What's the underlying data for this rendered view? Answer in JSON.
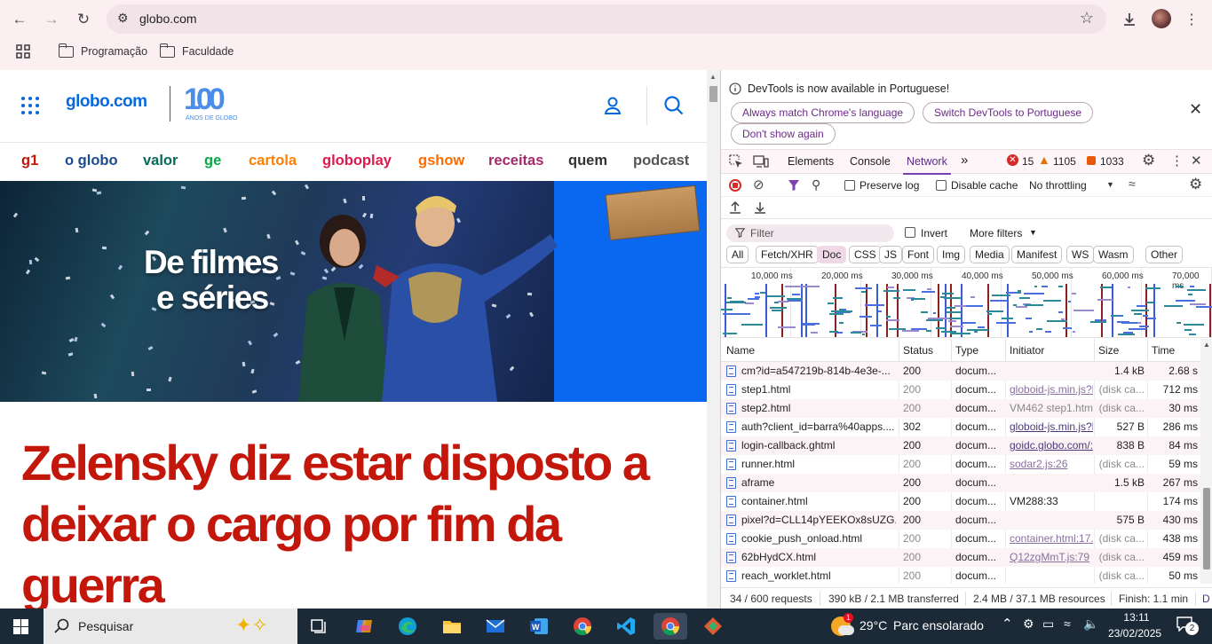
{
  "browser": {
    "url": "globo.com",
    "bookmarks": [
      "Programação",
      "Faculdade"
    ]
  },
  "globo": {
    "logo_text": "globo.com",
    "anniversary_logo": "100",
    "anniversary_sub": "ANOS DE GLOBO",
    "nav": [
      {
        "label": "g1",
        "color": "#c4170c"
      },
      {
        "label": "o globo",
        "color": "#1b4a94"
      },
      {
        "label": "valor",
        "color": "#086a57"
      },
      {
        "label": "ge",
        "color": "#06aa48"
      },
      {
        "label": "cartola",
        "color": "#ff7f00"
      },
      {
        "label": "globoplay",
        "color": "#e0194c"
      },
      {
        "label": "gshow",
        "color": "#ff6d00"
      },
      {
        "label": "receitas",
        "color": "#a6286b"
      },
      {
        "label": "quem",
        "color": "#333333"
      },
      {
        "label": "podcast",
        "color": "#555555"
      }
    ],
    "banner_text_line1": "De filmes",
    "banner_text_line2": "e séries",
    "headline": "Zelensky diz estar disposto a deixar o cargo por fim da guerra"
  },
  "devtools": {
    "info_message": "DevTools is now available in Portuguese!",
    "info_buttons": [
      "Always match Chrome's language",
      "Switch DevTools to Portuguese",
      "Don't show again"
    ],
    "tabs": [
      "Elements",
      "Console",
      "Network"
    ],
    "active_tab": "Network",
    "errors": "15",
    "warnings": "1105",
    "issues": "1033",
    "preserve_log": "Preserve log",
    "disable_cache": "Disable cache",
    "throttling": "No throttling",
    "filter_placeholder": "Filter",
    "invert": "Invert",
    "more_filters": "More filters",
    "type_filters": [
      "All",
      "Fetch/XHR",
      "Doc",
      "CSS",
      "JS",
      "Font",
      "Img",
      "Media",
      "Manifest",
      "WS",
      "Wasm",
      "Other"
    ],
    "active_type": "Doc",
    "timeline_ticks": [
      "10,000 ms",
      "20,000 ms",
      "30,000 ms",
      "40,000 ms",
      "50,000 ms",
      "60,000 ms",
      "70,000 ms"
    ],
    "columns": [
      "Name",
      "Status",
      "Type",
      "Initiator",
      "Size",
      "Time"
    ],
    "requests": [
      {
        "name": "cm?id=a547219b-814b-4e3e-...",
        "status": "200",
        "type": "docum...",
        "initiator": "",
        "size": "1.4 kB",
        "time": "2.68 s",
        "dim": false
      },
      {
        "name": "step1.html",
        "status": "200",
        "type": "docum...",
        "initiator": "globoid-js.min.js?l",
        "size": "(disk ca...",
        "time": "712 ms",
        "dim": true
      },
      {
        "name": "step2.html",
        "status": "200",
        "type": "docum...",
        "initiator": "VM462 step1.html",
        "size": "(disk ca...",
        "time": "30 ms",
        "dim": true
      },
      {
        "name": "auth?client_id=barra%40apps....",
        "status": "302",
        "type": "docum...",
        "initiator": "globoid-js.min.js?l",
        "size": "527 B",
        "time": "286 ms",
        "dim": false
      },
      {
        "name": "login-callback.ghtml",
        "status": "200",
        "type": "docum...",
        "initiator": "goidc.globo.com/:",
        "size": "838 B",
        "time": "84 ms",
        "dim": false
      },
      {
        "name": "runner.html",
        "status": "200",
        "type": "docum...",
        "initiator": "sodar2.js:26",
        "size": "(disk ca...",
        "time": "59 ms",
        "dim": true
      },
      {
        "name": "aframe",
        "status": "200",
        "type": "docum...",
        "initiator": "",
        "size": "1.5 kB",
        "time": "267 ms",
        "dim": false
      },
      {
        "name": "container.html",
        "status": "200",
        "type": "docum...",
        "initiator": "VM288:33",
        "size": "",
        "time": "174 ms",
        "dim": false
      },
      {
        "name": "pixel?d=CLL14pYEEKOx8sUZG...",
        "status": "200",
        "type": "docum...",
        "initiator": "",
        "size": "575 B",
        "time": "430 ms",
        "dim": false
      },
      {
        "name": "cookie_push_onload.html",
        "status": "200",
        "type": "docum...",
        "initiator": "container.html:17...",
        "size": "(disk ca...",
        "time": "438 ms",
        "dim": true
      },
      {
        "name": "62bHydCX.html",
        "status": "200",
        "type": "docum...",
        "initiator": "Q12zgMmT.js:79",
        "size": "(disk ca...",
        "time": "459 ms",
        "dim": true
      },
      {
        "name": "reach_worklet.html",
        "status": "200",
        "type": "docum...",
        "initiator": "",
        "size": "(disk ca...",
        "time": "50 ms",
        "dim": true
      }
    ],
    "footer": {
      "requests": "34 / 600 requests",
      "transferred": "390 kB / 2.1 MB transferred",
      "resources": "2.4 MB / 37.1 MB resources",
      "finish": "Finish: 1.1 min",
      "extra": "D"
    }
  },
  "taskbar": {
    "search_placeholder": "Pesquisar",
    "weather_temp": "29°C",
    "weather_desc": "Parc ensolarado",
    "time": "13:11",
    "date": "23/02/2025",
    "notifications": "2"
  }
}
